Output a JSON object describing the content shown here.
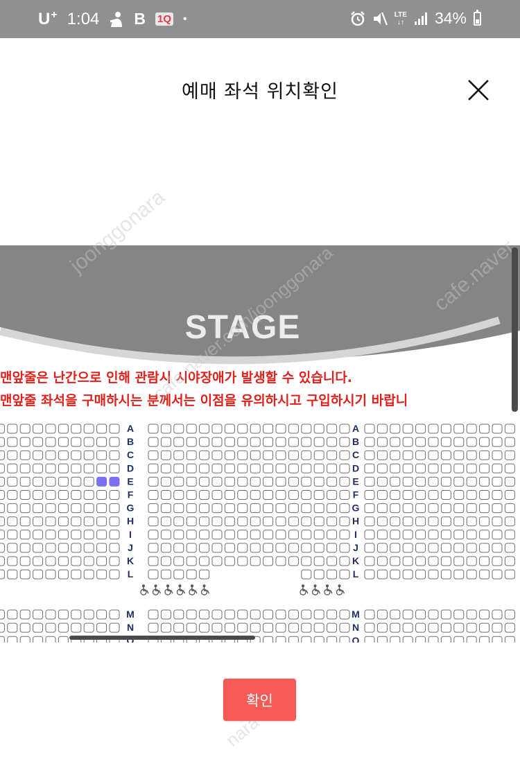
{
  "status_bar": {
    "carrier": "U",
    "carrier_sup": "+",
    "time": "1:04",
    "b_icon": "B",
    "app_badge": "1Q",
    "dot": "•",
    "network": "LTE",
    "battery": "34%"
  },
  "header": {
    "title": "예매 좌석 위치확인",
    "close_icon": "close-icon"
  },
  "seat_map": {
    "stage_label": "STAGE",
    "warning_line_1": "맨앞줄은 난간으로 인해 관람시 시야장애가 발생할 수 있습니다.",
    "warning_line_2": "맨앞줄 좌석을 구매하시는 분께서는 이점을 유의하시고 구입하시기 바랍니",
    "row_labels_upper": [
      "A",
      "B",
      "C",
      "D",
      "E",
      "F",
      "G",
      "H",
      "I",
      "J",
      "K",
      "L"
    ],
    "row_labels_lower": [
      "M",
      "N",
      "O"
    ],
    "selected_seats": [
      {
        "row": "E",
        "section": "left",
        "seat_from_aisle": 2
      },
      {
        "row": "E",
        "section": "left",
        "seat_from_aisle": 1
      }
    ],
    "wheelchair_icon": "wheelchair-icon",
    "wheelchair_left_count": 6,
    "wheelchair_right_count": 4,
    "watermarks": [
      "joonggonara",
      "cafe.naver",
      "cafe.naver.com/joonggonara",
      "nara"
    ]
  },
  "colors": {
    "status_bar_bg": "#909090",
    "stage_gray": "#858585",
    "warning_red": "#e0201a",
    "row_label_navy": "#1f2e63",
    "selected_seat": "#7b71f0",
    "confirm_button": "#f55a55"
  },
  "footer": {
    "confirm_label": "확인"
  }
}
